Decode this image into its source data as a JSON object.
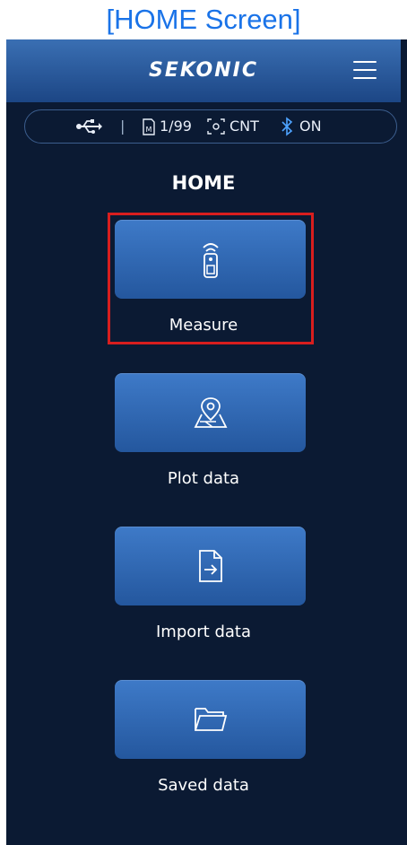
{
  "caption": "[HOME Screen]",
  "app": {
    "brand": "SEKONIC"
  },
  "status_bar": {
    "memory": "1/99",
    "mode": "CNT",
    "bluetooth": "ON"
  },
  "page_title": "HOME",
  "menu": [
    {
      "label": "Measure",
      "icon": "meter-remote-icon",
      "highlighted": true
    },
    {
      "label": "Plot data",
      "icon": "map-pin-icon"
    },
    {
      "label": "Import data",
      "icon": "file-import-icon"
    },
    {
      "label": "Saved data",
      "icon": "folder-icon"
    }
  ],
  "colors": {
    "background": "#0b1a33",
    "tile": "#2f67b0",
    "highlight": "#d81e1e",
    "caption": "#1a73e8"
  }
}
